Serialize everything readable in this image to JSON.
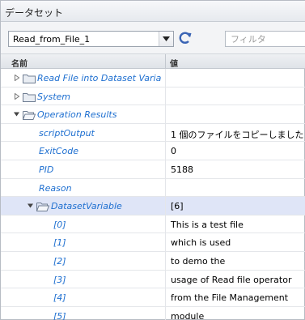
{
  "window": {
    "title": "データセット"
  },
  "toolbar": {
    "dataset_select": "Read_from_File_1",
    "filter_placeholder": "フィルタ"
  },
  "columns": {
    "name": "名前",
    "value": "値"
  },
  "rows": [
    {
      "label": "Read File into Dataset Varia",
      "value": "",
      "level": 0,
      "expander": "collapsed",
      "folder": "closed"
    },
    {
      "label": "System",
      "value": "",
      "level": 0,
      "expander": "collapsed",
      "folder": "closed"
    },
    {
      "label": "Operation Results",
      "value": "",
      "level": 0,
      "expander": "expanded",
      "folder": "open"
    },
    {
      "label": "scriptOutput",
      "value": "1 個のファイルをコピーしました",
      "level": 1,
      "expander": "none",
      "folder": "none"
    },
    {
      "label": "ExitCode",
      "value": "0",
      "level": 1,
      "expander": "none",
      "folder": "none"
    },
    {
      "label": "PID",
      "value": "5188",
      "level": 1,
      "expander": "none",
      "folder": "none"
    },
    {
      "label": "Reason",
      "value": "",
      "level": 1,
      "expander": "none",
      "folder": "none"
    },
    {
      "label": "DatasetVariable",
      "value": "[6]",
      "level": 1,
      "expander": "expanded",
      "folder": "open",
      "selected": true
    },
    {
      "label": "[0]",
      "value": "This is a test file",
      "level": 2,
      "expander": "none",
      "folder": "none"
    },
    {
      "label": "[1]",
      "value": "which is used",
      "level": 2,
      "expander": "none",
      "folder": "none"
    },
    {
      "label": "[2]",
      "value": "to demo the",
      "level": 2,
      "expander": "none",
      "folder": "none"
    },
    {
      "label": "[3]",
      "value": "usage of Read file operator",
      "level": 2,
      "expander": "none",
      "folder": "none"
    },
    {
      "label": "[4]",
      "value": "from the File Management",
      "level": 2,
      "expander": "none",
      "folder": "none"
    },
    {
      "label": "[5]",
      "value": "module",
      "level": 2,
      "expander": "none",
      "folder": "none"
    }
  ],
  "icons": {
    "dropdown": "chevron-down-icon",
    "refresh": "refresh-icon",
    "collapsed": "triangle-right-icon",
    "expanded": "triangle-down-icon",
    "folder_closed": "folder-icon",
    "folder_open": "folder-open-icon"
  },
  "colors": {
    "name_text": "#1e6fd0",
    "selected_row": "#dfe5f7",
    "header": "#e6e9ee"
  }
}
